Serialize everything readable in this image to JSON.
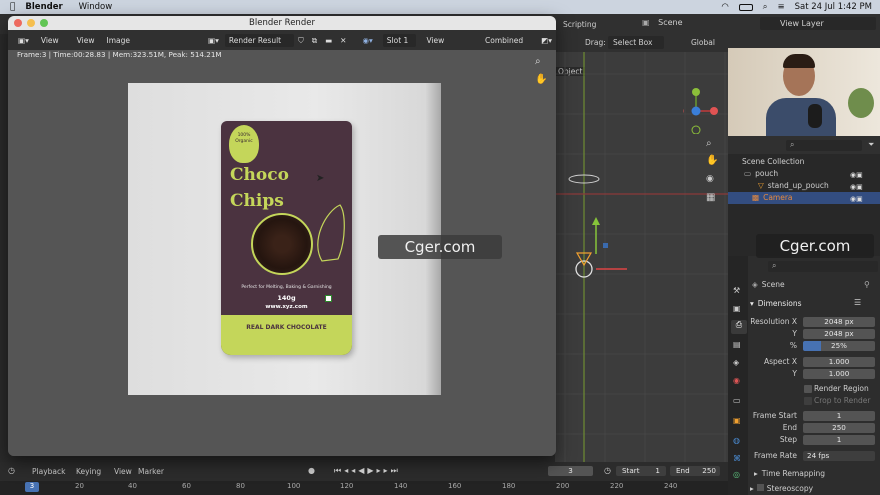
{
  "menubar": {
    "app": "Blender",
    "window": "Window",
    "date": "Sat 24 Jul  1:42 PM"
  },
  "render_window": {
    "title": "Blender Render",
    "menus": [
      "View",
      "View",
      "Image"
    ],
    "image_name": "Render Result",
    "slot": "Slot 1",
    "view_layer": "View Layer",
    "pass": "Combined",
    "stats": "Frame:3 | Time:00:28.83 | Mem:323.51M, Peak: 514.21M"
  },
  "pouch": {
    "badge": "100% Organic",
    "title1": "Choco",
    "title2": "Chips",
    "desc": "Perfect for Melting, Baking & Garnishing",
    "weight": "140g",
    "web": "www.xyz.com",
    "band": "REAL DARK CHOCOLATE"
  },
  "main_header": {
    "tab": "Scripting",
    "scene": "Scene",
    "view_layer": "View Layer",
    "drag_label": "Drag:",
    "drag_value": "Select Box",
    "orient": "Global",
    "object": "Object"
  },
  "outliner": {
    "items": [
      "Scene Collection",
      "pouch",
      "stand_up_pouch",
      "Camera"
    ]
  },
  "properties": {
    "scene": "Scene",
    "panel": "Dimensions",
    "res_x_label": "Resolution X",
    "res_x": "2048 px",
    "res_y_label": "Y",
    "res_y": "2048 px",
    "pct_label": "%",
    "pct": "25%",
    "aspect_x_label": "Aspect X",
    "aspect_x": "1.000",
    "aspect_y_label": "Y",
    "aspect_y": "1.000",
    "render_region": "Render Region",
    "crop": "Crop to Render ...",
    "fstart_label": "Frame Start",
    "fstart": "1",
    "fend_label": "End",
    "fend": "250",
    "fstep_label": "Step",
    "fstep": "1",
    "frate_label": "Frame Rate",
    "frate": "24 fps",
    "time_remap": "Time Remapping",
    "stereo": "Stereoscopy"
  },
  "timeline": {
    "menus": [
      "Playback",
      "Keying",
      "View",
      "Marker"
    ],
    "current": "3",
    "start_label": "Start",
    "start": "1",
    "end_label": "End",
    "end": "250",
    "ticks": [
      "3",
      "20",
      "40",
      "60",
      "80",
      "100",
      "120",
      "140",
      "160",
      "180",
      "200",
      "220",
      "240"
    ]
  },
  "watermark": "Cger.com",
  "colors": {
    "accent": "#4772b3",
    "pouch": "#4b3340",
    "lime": "#c4d65a"
  }
}
